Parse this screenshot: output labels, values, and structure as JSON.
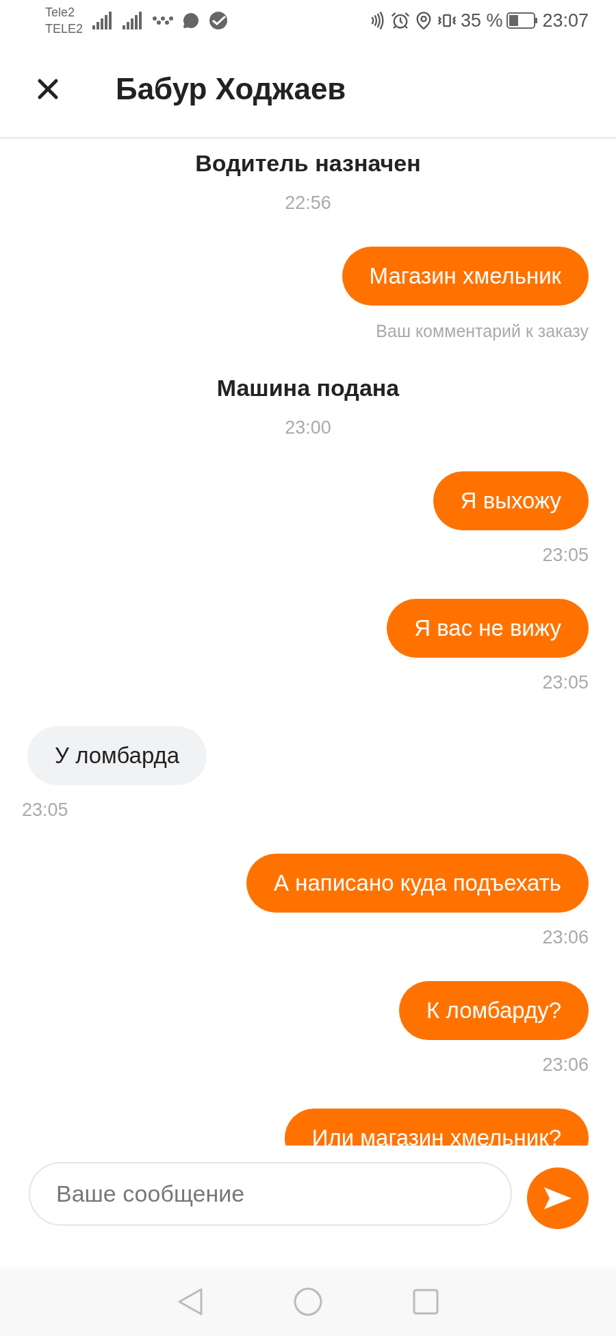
{
  "status_bar": {
    "carrier_1": "Tele2",
    "carrier_2": "TELE2",
    "battery": "35 %",
    "time": "23:07"
  },
  "header": {
    "title": "Бабур Ходжаев"
  },
  "messages": [
    {
      "kind": "system",
      "text": "Водитель назначен",
      "time": "22:56"
    },
    {
      "kind": "outgoing",
      "text": "Магазин хмельник",
      "caption": "Ваш комментарий к заказу"
    },
    {
      "kind": "system",
      "text": "Машина подана",
      "time": "23:00"
    },
    {
      "kind": "outgoing",
      "text": "Я выхожу",
      "time": "23:05"
    },
    {
      "kind": "outgoing",
      "text": "Я вас не вижу",
      "time": "23:05"
    },
    {
      "kind": "incoming",
      "text": "У ломбарда",
      "time": "23:05"
    },
    {
      "kind": "outgoing",
      "text": "А написано куда подъехать",
      "time": "23:06"
    },
    {
      "kind": "outgoing",
      "text": "К ломбарду?",
      "time": "23:06"
    },
    {
      "kind": "outgoing",
      "text": "Или магазин хмельник?"
    }
  ],
  "composer": {
    "placeholder": "Ваше сообщение"
  }
}
